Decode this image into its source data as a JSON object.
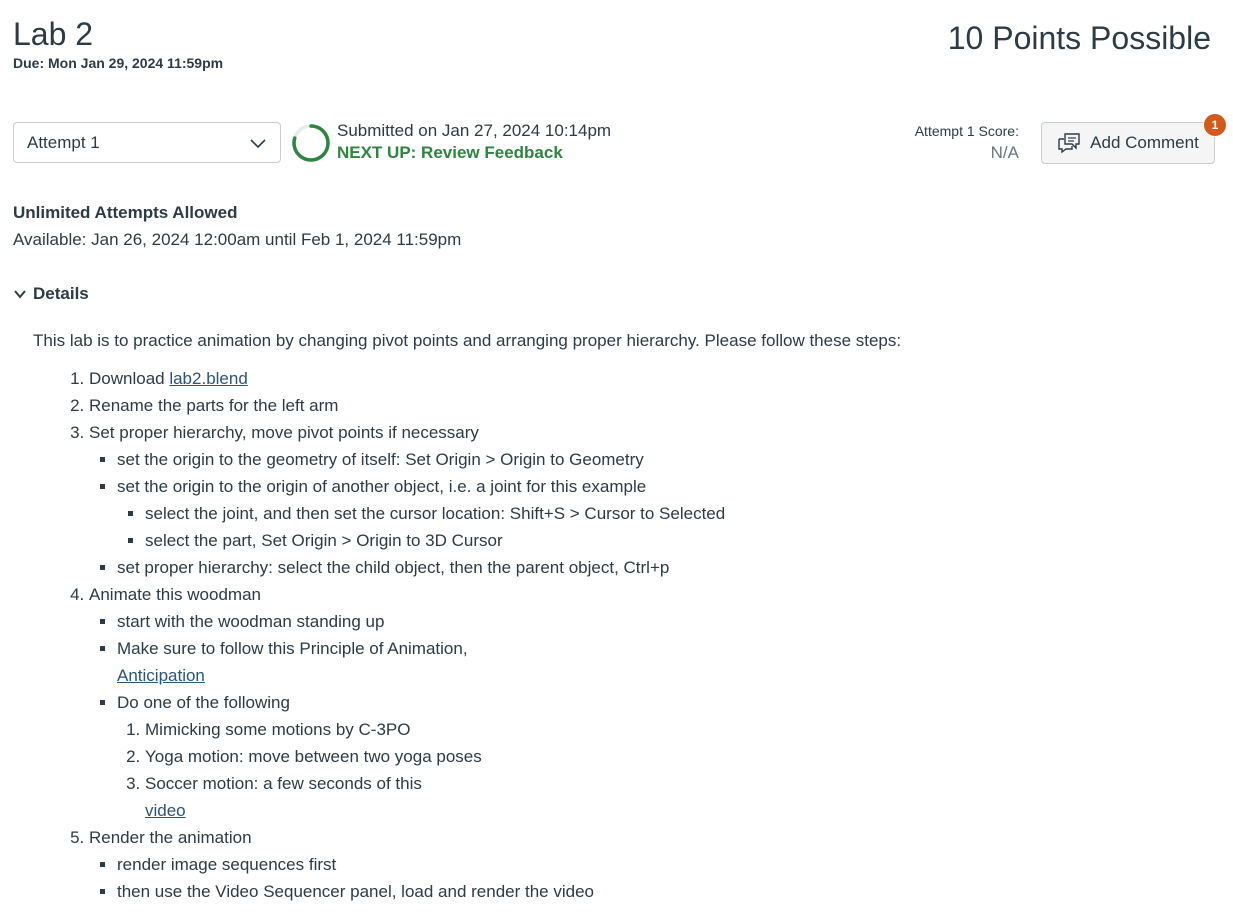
{
  "header": {
    "title": "Lab 2",
    "due": "Due: Mon Jan 29, 2024 11:59pm",
    "points": "10 Points Possible"
  },
  "submission": {
    "attempt_selected": "Attempt 1",
    "submitted": "Submitted on Jan 27, 2024 10:14pm",
    "next_up": "NEXT UP: Review Feedback",
    "score_label": "Attempt 1 Score:",
    "score_value": "N/A",
    "add_comment_label": "Add Comment",
    "comment_count": "1",
    "colors": {
      "next_up": "#2e8540",
      "badge": "#d35a1a",
      "link": "#2b5478"
    }
  },
  "info": {
    "attempts": "Unlimited Attempts Allowed",
    "available": "Available: Jan 26, 2024 12:00am until Feb 1, 2024 11:59pm"
  },
  "details": {
    "toggle_label": "Details",
    "intro": "This lab is to practice animation by changing pivot points and arranging proper hierarchy.  Please follow these steps:",
    "steps": {
      "s1_text": "Download ",
      "s1_link": "lab2.blend",
      "s2": "Rename the parts for the left arm",
      "s3": "Set proper hierarchy, move pivot points if necessary",
      "s3_a": "set the origin to the geometry of itself:  Set Origin > Origin to Geometry",
      "s3_b": "set the origin to the origin of another object, i.e. a joint for this example",
      "s3_b_i": "select the joint, and then set the cursor location: Shift+S > Cursor to Selected",
      "s3_b_ii": "select the part, Set Origin > Origin to 3D Cursor",
      "s3_c": "set proper hierarchy: select the child object, then the parent object, Ctrl+p",
      "s4": "Animate this woodman",
      "s4_a": "start with the woodman standing up",
      "s4_b": "Make sure to follow this Principle of Animation,",
      "s4_b_link": "Anticipation",
      "s4_c": "Do one of the following",
      "s4_c_1": "Mimicking some motions by C-3PO",
      "s4_c_2": "Yoga motion: move between two yoga poses",
      "s4_c_3": "Soccer motion: a few seconds of this",
      "s4_c_3_link": "video",
      "s5": "Render the animation",
      "s5_a": "render image sequences first",
      "s5_b": "then use the Video Sequencer panel, load and render the video"
    }
  }
}
